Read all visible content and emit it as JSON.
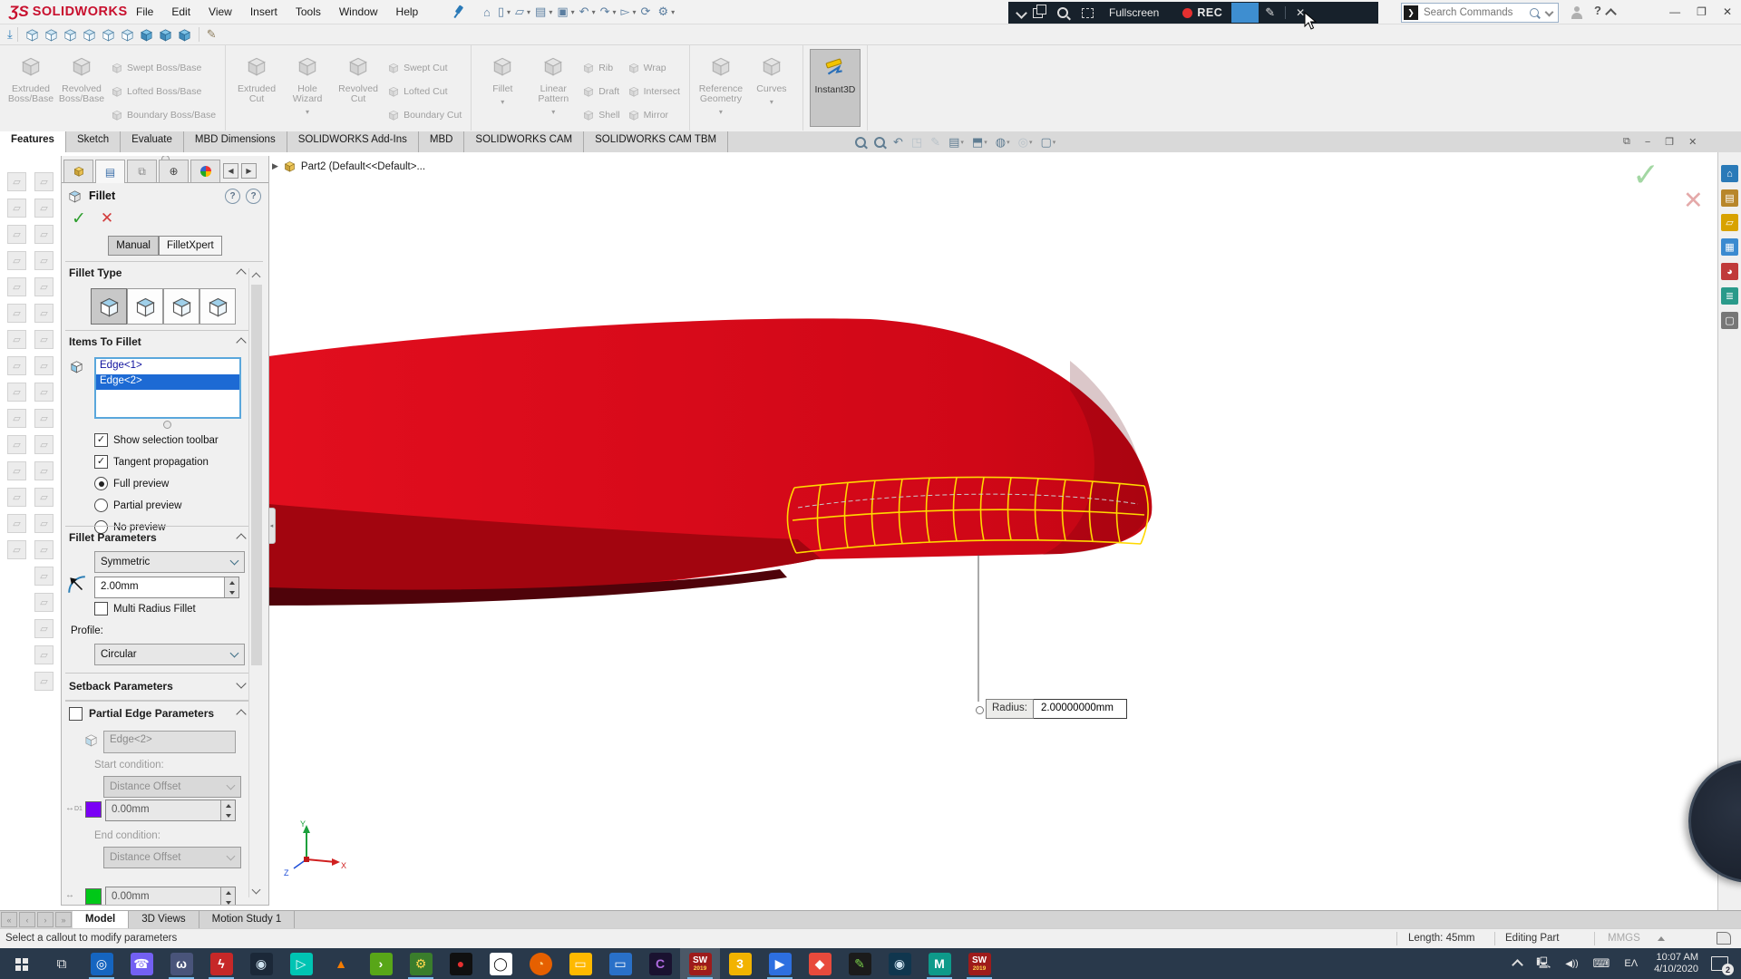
{
  "window": {
    "brand": "SOLIDWORKS",
    "menus": [
      "File",
      "Edit",
      "View",
      "Insert",
      "Tools",
      "Window",
      "Help"
    ],
    "search_placeholder": "Search Commands"
  },
  "rec": {
    "fullscreen": "Fullscreen",
    "rec": "REC"
  },
  "qat": [
    {
      "n": "home",
      "g": "⌂"
    },
    {
      "n": "new-document",
      "g": "▯",
      "dd": 1
    },
    {
      "n": "open",
      "g": "▱",
      "dd": 1
    },
    {
      "n": "save",
      "g": "▤",
      "dd": 1
    },
    {
      "n": "print",
      "g": "▣",
      "dd": 1
    },
    {
      "n": "undo",
      "g": "↶",
      "dd": 1
    },
    {
      "n": "redo",
      "g": "↷",
      "dd": 1
    },
    {
      "n": "select",
      "g": "▻",
      "dd": 1
    },
    {
      "n": "rebuild",
      "g": "⟳"
    },
    {
      "n": "options",
      "g": "⚙",
      "dd": 1
    }
  ],
  "viewbar": {
    "cubes": [
      "o",
      "o",
      "o",
      "o",
      "o",
      "o",
      "s",
      "s",
      "s"
    ]
  },
  "ribbon": {
    "groups": [
      {
        "items": [
          {
            "l": "Extruded|Boss/Base"
          },
          {
            "l": "Revolved|Boss/Base"
          },
          {
            "stack": [
              "Swept Boss/Base",
              "Lofted Boss/Base",
              "Boundary Boss/Base"
            ]
          }
        ]
      },
      {
        "items": [
          {
            "l": "Extruded|Cut"
          },
          {
            "l": "Hole|Wizard",
            "dd": 1
          },
          {
            "l": "Revolved|Cut"
          },
          {
            "stack": [
              "Swept Cut",
              "Lofted Cut",
              "Boundary Cut"
            ]
          }
        ]
      },
      {
        "items": [
          {
            "l": "Fillet",
            "dd": 1
          },
          {
            "l": "Linear|Pattern",
            "dd": 1
          },
          {
            "stack": [
              "Rib",
              "Draft",
              "Shell"
            ]
          },
          {
            "stack": [
              "Wrap",
              "Intersect",
              "Mirror"
            ]
          }
        ]
      },
      {
        "items": [
          {
            "l": "Reference|Geometry",
            "dd": 1
          },
          {
            "l": "Curves",
            "dd": 1
          }
        ]
      },
      {
        "items": [
          {
            "l": "Instant3D",
            "active": 1
          }
        ]
      }
    ]
  },
  "tabs": {
    "items": [
      "Features",
      "Sketch",
      "Evaluate",
      "MBD Dimensions",
      "SOLIDWORKS Add-Ins",
      "MBD",
      "SOLIDWORKS CAM",
      "SOLIDWORKS CAM TBM"
    ],
    "active": 0
  },
  "headsup": [
    {
      "n": "zoom-fit",
      "mag": 1
    },
    {
      "n": "zoom-area",
      "mag": 1
    },
    {
      "n": "previous-view",
      "g": "↶"
    },
    {
      "n": "section-view",
      "g": "◳",
      "dim": 1
    },
    {
      "n": "sketch-annotation",
      "g": "✎",
      "dim": 1
    },
    {
      "n": "edit-appearance",
      "g": "▤",
      "dd": 1
    },
    {
      "n": "view-orientation",
      "g": "⬒",
      "dd": 1
    },
    {
      "n": "display-style",
      "g": "◍",
      "dd": 1
    },
    {
      "n": "hide-show-items",
      "g": "◎",
      "dd": 1,
      "dim": 1
    },
    {
      "n": "view-settings",
      "g": "▢",
      "dd": 1
    }
  ],
  "docwin_icons": [
    "⧉",
    "−",
    "❐",
    "✕"
  ],
  "viewport": {
    "tree": "Part2  (Default<<Default>...",
    "callout_label": "Radius:",
    "callout_value": "2.00000000mm"
  },
  "pm": {
    "title": "Fillet",
    "mode_tabs": [
      "Manual",
      "FilletXpert"
    ],
    "fillet_type_label": "Fillet Type",
    "items_label": "Items To Fillet",
    "edges": [
      "Edge<1>",
      "Edge<2>"
    ],
    "selected_edge": 1,
    "checks": [
      {
        "label": "Show selection toolbar",
        "checked": true
      },
      {
        "label": "Tangent propagation",
        "checked": true
      }
    ],
    "previews": [
      {
        "label": "Full preview",
        "sel": true
      },
      {
        "label": "Partial preview",
        "sel": false
      },
      {
        "label": "No preview",
        "sel": false
      }
    ],
    "params_label": "Fillet Parameters",
    "symmetry": "Symmetric",
    "radius": "2.00mm",
    "multi_radius": "Multi Radius Fillet",
    "profile_label": "Profile:",
    "profile": "Circular",
    "setback_label": "Setback Parameters",
    "partial_label": "Partial Edge Parameters",
    "partial_edge": "Edge<2>",
    "start_label": "Start condition:",
    "start_value": "Distance Offset",
    "offset1": "0.00mm",
    "end_label": "End condition:",
    "end_value": "Distance Offset",
    "offset2": "0.00mm"
  },
  "doc_tabs": {
    "items": [
      "Model",
      "3D Views",
      "Motion Study 1"
    ],
    "active": 0
  },
  "statusbar": {
    "message": "Select a callout to modify parameters",
    "length": "Length: 45mm",
    "mode": "Editing Part",
    "units": "MMGS"
  },
  "taskbar": {
    "icons": [
      {
        "n": "tracen",
        "g": "◎",
        "bg": "#1565c0",
        "fg": "#fff",
        "active": true
      },
      {
        "n": "viber",
        "g": "☎",
        "bg": "#7360f2",
        "fg": "#fff"
      },
      {
        "n": "discord",
        "g": "ω",
        "bg": "#49547a",
        "fg": "#fff",
        "active": true
      },
      {
        "n": "lightning",
        "g": "ϟ",
        "bg": "#c62828",
        "fg": "#fff",
        "active": true
      },
      {
        "n": "steam",
        "g": "◉",
        "bg": "#1b2838",
        "fg": "#cfe3f0"
      },
      {
        "n": "filmora",
        "g": "▷",
        "bg": "#00c4b3",
        "fg": "#fff"
      },
      {
        "n": "vlc",
        "g": "▲",
        "bg": "none",
        "fg": "#f57c00"
      },
      {
        "n": "leaf",
        "g": "›",
        "bg": "#58a618",
        "fg": "#fff"
      },
      {
        "n": "gear-17",
        "g": "⚙",
        "bg": "#3a7d2c",
        "fg": "#ffd84d",
        "active": true
      },
      {
        "n": "obs",
        "g": "●",
        "bg": "#101010",
        "fg": "#e53030"
      },
      {
        "n": "oculus",
        "g": "◯",
        "bg": "#ffffff",
        "fg": "#111"
      },
      {
        "n": "firefox",
        "g": "◔",
        "bg": "#e66000",
        "fg": "#ffd080",
        "round": 1
      },
      {
        "n": "file-explorer",
        "g": "▭",
        "bg": "#ffb900",
        "fg": "#fff"
      },
      {
        "n": "remote-app",
        "g": "▭",
        "bg": "#2970c8",
        "fg": "#fff"
      },
      {
        "n": "cinema4d",
        "g": "C",
        "bg": "#1a1230",
        "fg": "#b06ae0"
      },
      {
        "n": "solidworks-2019",
        "t1": "SW",
        "t2": "2019",
        "bg": "#9e1b1b",
        "fg": "#fff",
        "active": true,
        "hl": true
      },
      {
        "n": "golden-3",
        "g": "3",
        "bg": "#f2b300",
        "fg": "#fff"
      },
      {
        "n": "media-player",
        "g": "▶",
        "bg": "#2d6fe0",
        "fg": "#fff",
        "active": true
      },
      {
        "n": "red-diamond",
        "g": "◆",
        "bg": "#e84a3c",
        "fg": "#fff"
      },
      {
        "n": "green-pen",
        "g": "✎",
        "bg": "#1b1b1b",
        "fg": "#7ad24a"
      },
      {
        "n": "steam-2",
        "g": "◉",
        "bg": "#10364e",
        "fg": "#cfe3f0"
      },
      {
        "n": "maya",
        "g": "M",
        "bg": "#0e9a8a",
        "fg": "#fff",
        "active": true
      },
      {
        "n": "solidworks-2019-2",
        "t1": "SW",
        "t2": "2019",
        "bg": "#9e1b1b",
        "fg": "#fff",
        "active": true
      }
    ],
    "tray": {
      "lang": "EΛ",
      "time": "10:07 AM",
      "date": "4/10/2020",
      "badge": "2"
    }
  },
  "colors": {
    "model_red": "#d6091b",
    "model_dark": "#a2050f",
    "model_darkest": "#4f030a",
    "preview_yellow": "#ffd800",
    "selection_blue": "#1d6ad4",
    "taskbar_bg": "#29394b"
  }
}
